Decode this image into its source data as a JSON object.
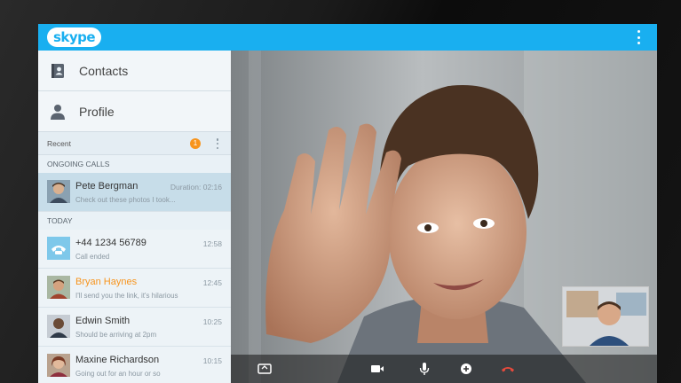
{
  "app": {
    "logo_text": "skype",
    "brand_color": "#19aff0",
    "accent_color": "#f7941d"
  },
  "nav": [
    {
      "label": "Contacts",
      "icon": "contacts-book-icon"
    },
    {
      "label": "Profile",
      "icon": "person-icon"
    }
  ],
  "recent": {
    "label": "Recent",
    "badge_count": "1"
  },
  "sections": {
    "ongoing": "ONGOING CALLS",
    "today": "TODAY"
  },
  "ongoing_calls": [
    {
      "name": "Pete Bergman",
      "subtitle": "Check out these photos I took...",
      "meta": "Duration: 02:16"
    }
  ],
  "today": [
    {
      "name": "+44 1234 56789",
      "subtitle": "Call ended",
      "meta": "12:58",
      "icon": "phone-icon"
    },
    {
      "name": "Bryan Haynes",
      "subtitle": "I'll send you the link, it's hilarious",
      "meta": "12:45"
    },
    {
      "name": "Edwin Smith",
      "subtitle": "Should be arriving at 2pm",
      "meta": "10:25"
    },
    {
      "name": "Maxine Richardson",
      "subtitle": "Going out for an hour or so",
      "meta": "10:15"
    }
  ],
  "call_controls": [
    {
      "name": "switch-camera-icon"
    },
    {
      "name": "video-camera-icon"
    },
    {
      "name": "microphone-icon"
    },
    {
      "name": "add-participant-icon"
    },
    {
      "name": "end-call-icon"
    }
  ]
}
